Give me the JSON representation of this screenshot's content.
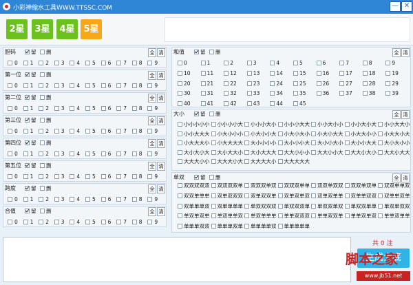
{
  "window": {
    "title": "小彩神缩水工具WWW.TTSSC.COM",
    "minimize_symbol": "—",
    "close_symbol": "✕"
  },
  "colors": {
    "titlebar": "#2f86d6",
    "star_green": "#6cc11f",
    "star_orange": "#f7a718",
    "generate": "#2fb4e8",
    "count": "#dd2222"
  },
  "stars": [
    {
      "label": "2星",
      "color": "green"
    },
    {
      "label": "3星",
      "color": "green"
    },
    {
      "label": "4星",
      "color": "green"
    },
    {
      "label": "5星",
      "color": "orange"
    }
  ],
  "common": {
    "keep": "留",
    "delete": "删",
    "all": "全",
    "clear": "清"
  },
  "left_panels": [
    {
      "title": "胆码",
      "digits": [
        "0",
        "1",
        "2",
        "3",
        "4",
        "5",
        "6",
        "7",
        "8",
        "9"
      ]
    },
    {
      "title": "第一位",
      "digits": [
        "0",
        "1",
        "2",
        "3",
        "4",
        "5",
        "6",
        "7",
        "8",
        "9"
      ]
    },
    {
      "title": "第二位",
      "digits": [
        "0",
        "1",
        "2",
        "3",
        "4",
        "5",
        "6",
        "7",
        "8",
        "9"
      ]
    },
    {
      "title": "第三位",
      "digits": [
        "0",
        "1",
        "2",
        "3",
        "4",
        "5",
        "6",
        "7",
        "8",
        "9"
      ]
    },
    {
      "title": "第四位",
      "digits": [
        "0",
        "1",
        "2",
        "3",
        "4",
        "5",
        "6",
        "7",
        "8",
        "9"
      ]
    },
    {
      "title": "第五位",
      "digits": [
        "0",
        "1",
        "2",
        "3",
        "4",
        "5",
        "6",
        "7",
        "8",
        "9"
      ]
    },
    {
      "title": "跨度",
      "digits": [
        "0",
        "1",
        "2",
        "3",
        "4",
        "5",
        "6",
        "7",
        "8",
        "9"
      ]
    },
    {
      "title": "合值",
      "digits": [
        "0",
        "1",
        "2",
        "3",
        "4",
        "5",
        "6",
        "7",
        "8",
        "9"
      ]
    }
  ],
  "hezhi": {
    "title": "和值",
    "values": [
      "0",
      "1",
      "2",
      "3",
      "4",
      "5",
      "6",
      "7",
      "8",
      "9",
      "10",
      "11",
      "12",
      "13",
      "14",
      "15",
      "16",
      "17",
      "18",
      "19",
      "20",
      "21",
      "22",
      "23",
      "24",
      "25",
      "26",
      "27",
      "28",
      "29",
      "30",
      "31",
      "32",
      "33",
      "34",
      "35",
      "36",
      "37",
      "38",
      "39",
      "40",
      "41",
      "42",
      "43",
      "44",
      "45"
    ]
  },
  "daxiao": {
    "title": "大小",
    "values": [
      "小小小小小",
      "小小小小大",
      "小小小大小",
      "小小小大大",
      "小小大小小",
      "小小大小大",
      "小小大大小",
      "小小大大大",
      "小大小小小",
      "小大小小大",
      "小大小大小",
      "小大小大大",
      "小大大小小",
      "小大大小大",
      "小大大大小",
      "小大大大大",
      "大小小小小",
      "大小小小大",
      "大小小大小",
      "大小小大大",
      "大小大小小",
      "大小大小大",
      "大小大大小",
      "大小大大大",
      "大大小小小",
      "大大小小大",
      "大大小大小",
      "大大小大大",
      "大大大小小",
      "大大大小大",
      "大大大大小",
      "大大大大大"
    ]
  },
  "danshuang": {
    "title": "单双",
    "values": [
      "双双双双双",
      "双双双双单",
      "双双双单双",
      "双双双单单",
      "双双单双双",
      "双双单双单",
      "双双单单双",
      "双双单单单",
      "双单双双双",
      "双单双双单",
      "双单双单双",
      "双单双单单",
      "双单单双双",
      "双单单双单",
      "双单单单双",
      "双单单单单",
      "单双双双双",
      "单双双双单",
      "单双双单双",
      "单双双单单",
      "单双单双双",
      "单双单双单",
      "单双单单双",
      "单双单单单",
      "单单双双双",
      "单单双双单",
      "单单双单双",
      "单单双单单",
      "单单单双双",
      "单单单双单",
      "单单单单双",
      "单单单单单"
    ]
  },
  "result": {
    "count_text": "共 0 注",
    "generate_label": "生成大底"
  },
  "watermark": {
    "line1": "脚本之家",
    "line2": "www.jb51.net"
  }
}
